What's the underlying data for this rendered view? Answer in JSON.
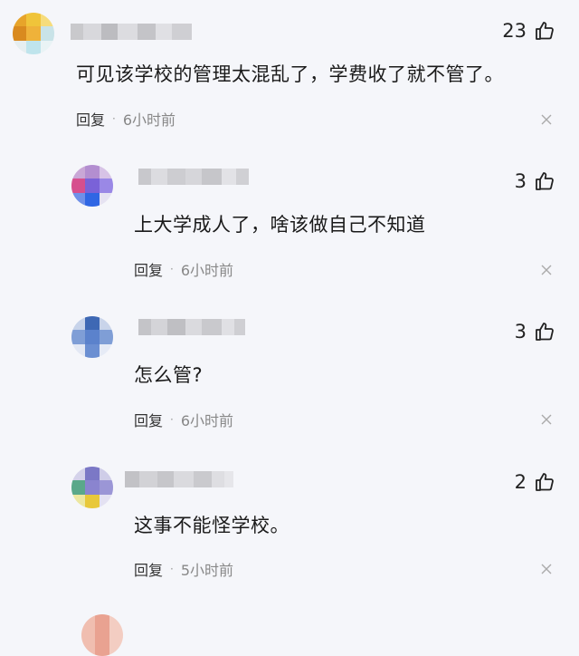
{
  "icons": {
    "like": "thumbs-up-icon",
    "close": "close-icon"
  },
  "comments": [
    {
      "likes": "23",
      "text": "可见该学校的管理太混乱了，学费收了就不管了。",
      "reply_label": "回复",
      "dot": "·",
      "time": "6小时前"
    },
    {
      "likes": "3",
      "text": "上大学成人了，啥该做自己不知道",
      "reply_label": "回复",
      "dot": "·",
      "time": "6小时前"
    },
    {
      "likes": "3",
      "text": "怎么管?",
      "reply_label": "回复",
      "dot": "·",
      "time": "6小时前"
    },
    {
      "likes": "2",
      "text": "这事不能怪学校。",
      "reply_label": "回复",
      "dot": "·",
      "time": "5小时前"
    }
  ]
}
